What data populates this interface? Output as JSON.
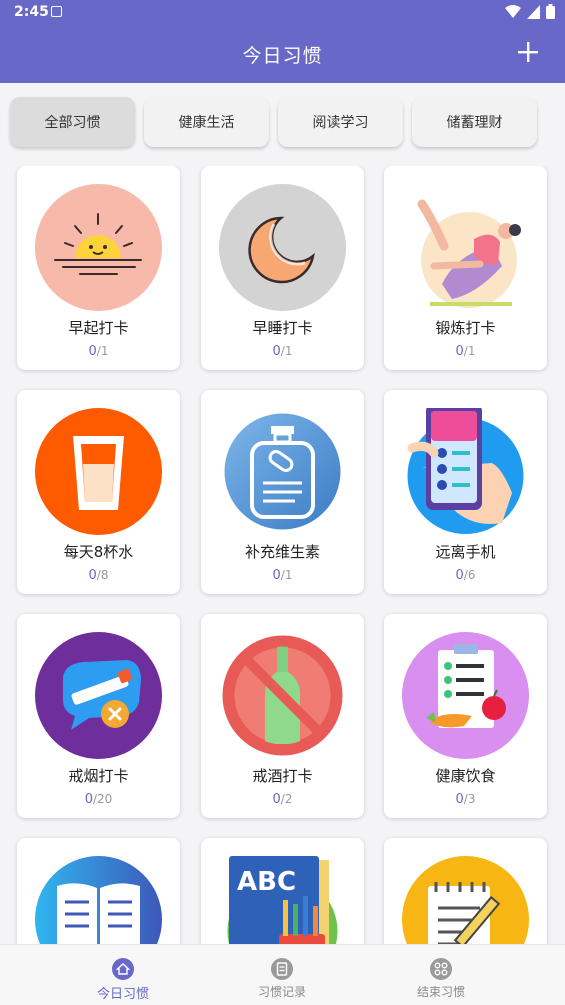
{
  "status": {
    "time": "2:45"
  },
  "appbar": {
    "title": "今日习惯"
  },
  "tabs": [
    {
      "label": "全部习惯",
      "active": true
    },
    {
      "label": "健康生活",
      "active": false
    },
    {
      "label": "阅读学习",
      "active": false
    },
    {
      "label": "储蓄理财",
      "active": false
    }
  ],
  "habits": [
    {
      "name": "早起打卡",
      "done": "0",
      "total": "/1",
      "icon": "sunrise-icon"
    },
    {
      "name": "早睡打卡",
      "done": "0",
      "total": "/1",
      "icon": "moon-icon"
    },
    {
      "name": "锻炼打卡",
      "done": "0",
      "total": "/1",
      "icon": "yoga-icon"
    },
    {
      "name": "每天8杯水",
      "done": "0",
      "total": "/8",
      "icon": "water-glass-icon"
    },
    {
      "name": "补充维生素",
      "done": "0",
      "total": "/1",
      "icon": "vitamin-bottle-icon"
    },
    {
      "name": "远离手机",
      "done": "0",
      "total": "/6",
      "icon": "phone-hand-icon"
    },
    {
      "name": "戒烟打卡",
      "done": "0",
      "total": "/20",
      "icon": "no-smoking-icon"
    },
    {
      "name": "戒酒打卡",
      "done": "0",
      "total": "/2",
      "icon": "no-alcohol-icon"
    },
    {
      "name": "健康饮食",
      "done": "0",
      "total": "/3",
      "icon": "diet-checklist-icon"
    },
    {
      "name": "",
      "done": "",
      "total": "",
      "icon": "open-book-icon"
    },
    {
      "name": "",
      "done": "",
      "total": "",
      "icon": "abc-book-pencils-icon"
    },
    {
      "name": "",
      "done": "",
      "total": "",
      "icon": "notepad-pencil-icon"
    }
  ],
  "nav": [
    {
      "label": "今日习惯",
      "icon": "home-icon",
      "active": true
    },
    {
      "label": "习惯记录",
      "icon": "record-icon",
      "active": false
    },
    {
      "label": "结束习惯",
      "icon": "grid-icon",
      "active": false
    }
  ],
  "colors": {
    "primary": "#6868c8"
  }
}
